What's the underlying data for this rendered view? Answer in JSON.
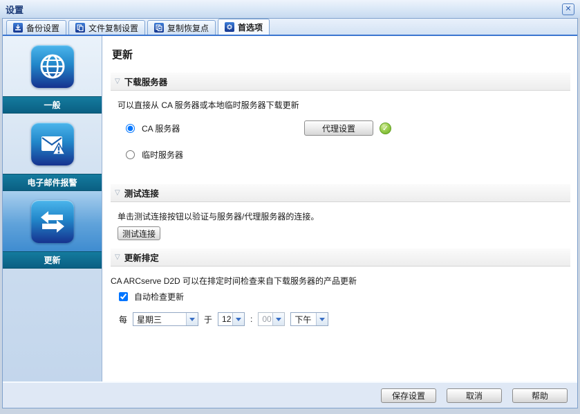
{
  "window": {
    "title": "设置"
  },
  "tabs": [
    {
      "label": "备份设置"
    },
    {
      "label": "文件复制设置"
    },
    {
      "label": "复制恢复点"
    },
    {
      "label": "首选项"
    }
  ],
  "sidebar": {
    "items": [
      {
        "label": "一般",
        "icon": "globe-icon",
        "selected": false
      },
      {
        "label": "电子邮件报警",
        "icon": "email-alert-icon",
        "selected": false
      },
      {
        "label": "更新",
        "icon": "update-arrows-icon",
        "selected": true
      }
    ]
  },
  "main": {
    "title": "更新",
    "download_server": {
      "header": "下载服务器",
      "description": "可以直接从 CA 服务器或本地临时服务器下载更新",
      "ca_server_label": "CA 服务器",
      "staging_server_label": "临时服务器",
      "ca_server_selected": true,
      "proxy_button_label": "代理设置",
      "proxy_status_icon": "green-check-icon"
    },
    "test_connection": {
      "header": "测试连接",
      "description": "单击测试连接按钮以验证与服务器/代理服务器的连接。",
      "test_button_label": "测试连接"
    },
    "update_schedule": {
      "header": "更新排定",
      "description": "CA ARCserve D2D 可以在排定时间检查来自下载服务器的产品更新",
      "auto_check_label": "自动检查更新",
      "auto_check_checked": true,
      "every_label": "每",
      "day_value": "星期三",
      "at_label": "于",
      "hour_value": "12",
      "separator": ":",
      "minute_value": "00",
      "ampm_value": "下午"
    }
  },
  "footer": {
    "save_label": "保存设置",
    "cancel_label": "取消",
    "help_label": "帮助"
  },
  "colors": {
    "sidebar_band_teal": "#0e6b8e",
    "tab_underline_blue": "#3a75d0",
    "icon_tile_top": "#4cb6ec",
    "icon_tile_bottom": "#16328f",
    "selected_item_bg": "#3f8cd0",
    "green_check": "#6cae24",
    "titlebar_text": "#1e3c78"
  }
}
